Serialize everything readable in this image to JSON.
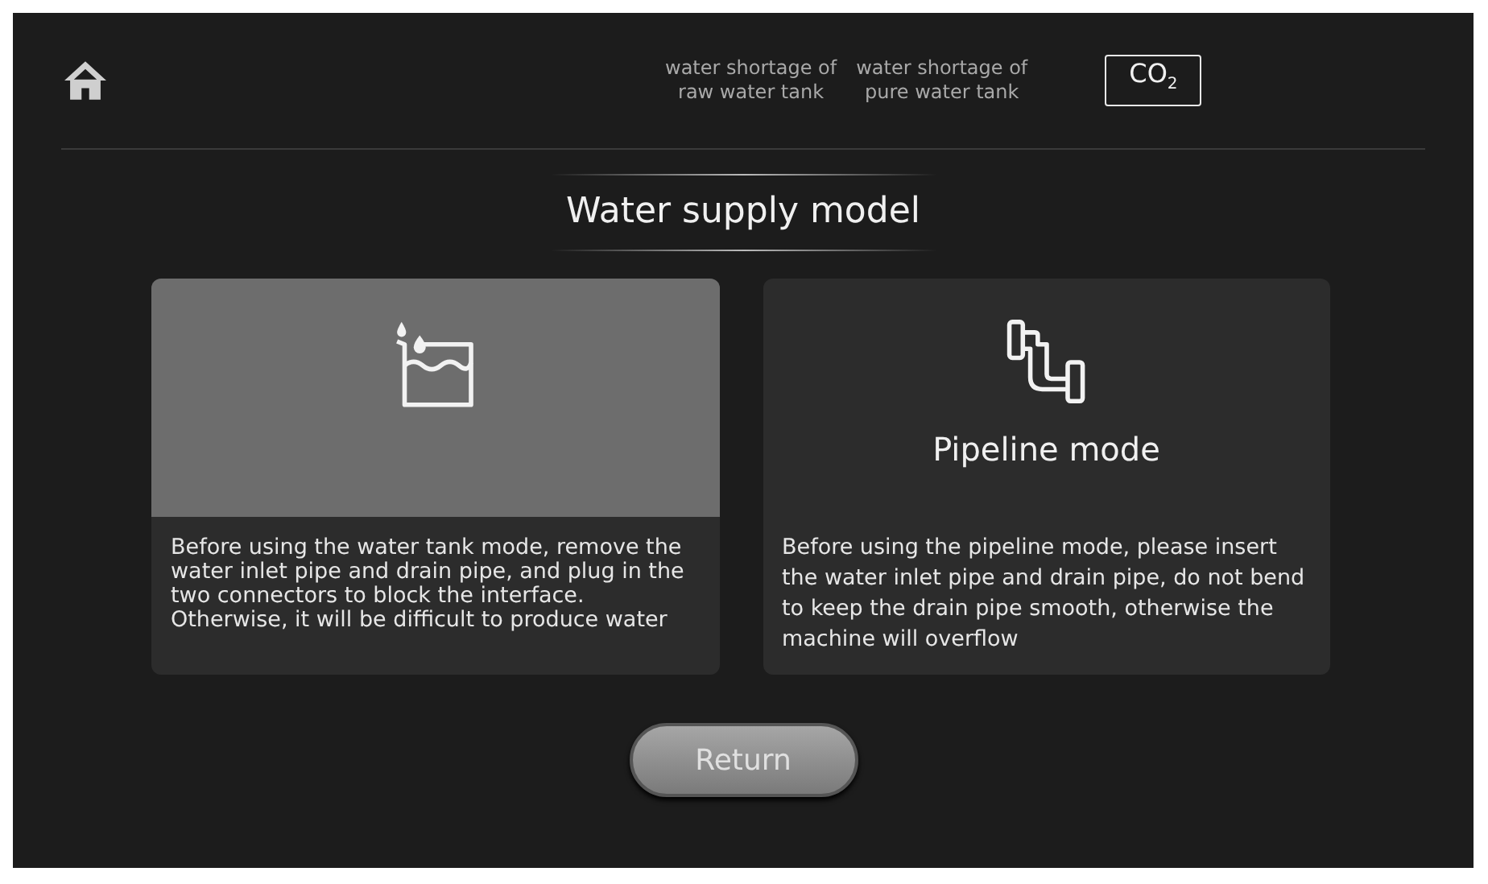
{
  "header": {
    "alerts": [
      {
        "line1": "water shortage of",
        "line2": "raw water tank"
      },
      {
        "line1": "water shortage of",
        "line2": "pure water tank"
      }
    ],
    "co2_badge": "CO$_{2}$"
  },
  "title": "Water supply model",
  "modes": [
    {
      "kind": "tank",
      "selected": true,
      "description": "Before using the water tank mode, remove the water inlet pipe and drain pipe, and plug in the two connectors to block the interface. Otherwise, it will be difficult to produce water"
    },
    {
      "kind": "pipeline",
      "selected": false,
      "label": "Pipeline mode",
      "description": "Before using the pipeline mode, please insert the water inlet pipe and drain pipe, do not bend to keep the drain pipe smooth, otherwise the machine will overflow"
    }
  ],
  "buttons": [
    {
      "label": "Return"
    }
  ]
}
